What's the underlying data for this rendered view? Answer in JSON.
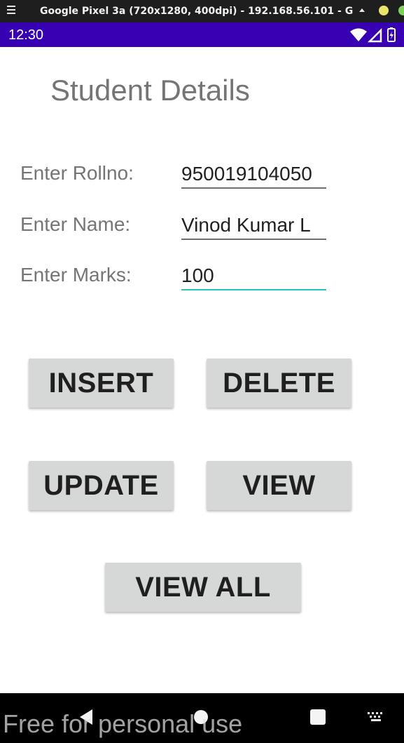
{
  "emulator": {
    "window_title": "Google Pixel 3a (720x1280, 400dpi) - 192.168.56.101 - G"
  },
  "status_bar": {
    "time": "12:30",
    "icons": [
      "wifi-icon",
      "signal-icon",
      "battery-icon"
    ],
    "background": "#3700b3"
  },
  "app": {
    "title": "Student Details",
    "fields": [
      {
        "label": "Enter Rollno:",
        "value": "950019104050",
        "focused": false
      },
      {
        "label": "Enter Name:",
        "value": "Vinod Kumar L",
        "focused": false
      },
      {
        "label": "Enter Marks:",
        "value": "100",
        "focused": true
      }
    ],
    "buttons": {
      "insert": "INSERT",
      "delete": "DELETE",
      "update": "UPDATE",
      "view": "VIEW",
      "view_all": "VIEW ALL"
    },
    "colors": {
      "accent": "#26c6b9",
      "button": "#d6d7d7",
      "label": "#757575"
    }
  },
  "nav_bar": {
    "icons": [
      "back-icon",
      "home-icon",
      "recent-apps-icon",
      "keyboard-icon"
    ]
  },
  "watermark": "Free for personal use"
}
